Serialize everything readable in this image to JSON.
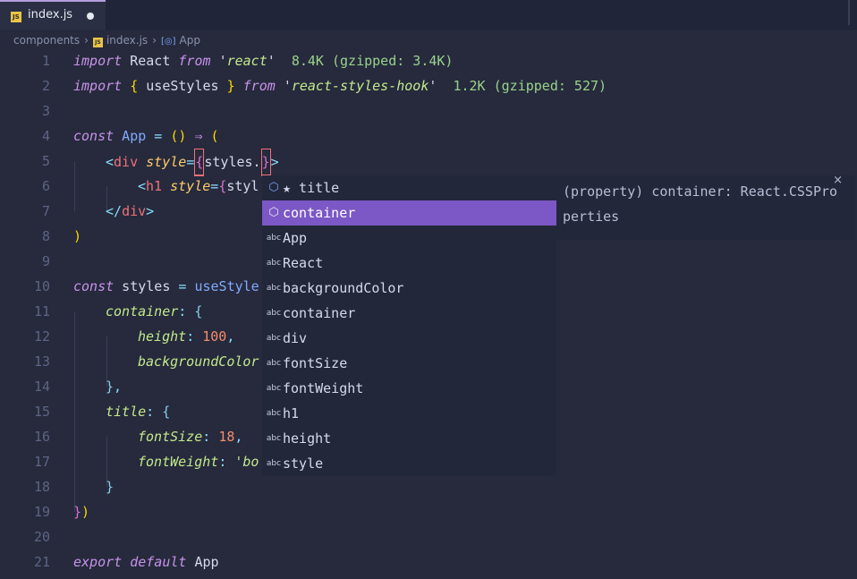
{
  "tab": {
    "icon_label": "JS",
    "name": "index.js"
  },
  "breadcrumb": {
    "folder": "components",
    "file": "index.js",
    "symbol": "App"
  },
  "line_numbers": [
    "1",
    "2",
    "3",
    "4",
    "5",
    "6",
    "7",
    "8",
    "9",
    "10",
    "11",
    "12",
    "13",
    "14",
    "15",
    "16",
    "17",
    "18",
    "19",
    "20",
    "21"
  ],
  "code": {
    "l1": {
      "kw1": "import",
      "id": " React ",
      "kw2": "from",
      "sp": " ",
      "q1": "'",
      "mod": "react",
      "q2": "'",
      "hint": "  8.4K (gzipped: 3.4K)"
    },
    "l2": {
      "kw1": "import",
      "ob": " { ",
      "id": "useStyles",
      "cb": " } ",
      "kw2": "from",
      "sp": " ",
      "q1": "'",
      "mod": "react-styles-hook",
      "q2": "'",
      "hint": "  1.2K (gzipped: 527)"
    },
    "l4": {
      "kw": "const",
      "name": " App",
      "eq": " = ",
      "p": "()",
      "arrow": " ⇒ ",
      "open": "("
    },
    "l5": {
      "lt": "<",
      "tag": "div",
      "attr": " style",
      "eq": "=",
      "ob": "{",
      "obj": "styles.",
      "cb": "}",
      "gt": ">"
    },
    "l6": {
      "lt": "<",
      "tag": "h1",
      "attr": " style",
      "eq": "=",
      "ob": "{",
      "obj": "styl"
    },
    "l7": {
      "lt": "</",
      "tag": "div",
      "gt": ">"
    },
    "l8": {
      "close": ")"
    },
    "l10": {
      "kw": "const",
      "name": " styles",
      "eq": " = ",
      "fn": "useStyle"
    },
    "l11": {
      "prop": "container",
      "colon": ": ",
      "ob": "{"
    },
    "l12": {
      "prop": "height",
      "colon": ": ",
      "num": "100",
      "comma": ","
    },
    "l13": {
      "prop": "backgroundColor"
    },
    "l14": {
      "cb": "}",
      "comma": ","
    },
    "l15": {
      "prop": "title",
      "colon": ": ",
      "ob": "{"
    },
    "l16": {
      "prop": "fontSize",
      "colon": ": ",
      "num": "18",
      "comma": ","
    },
    "l17": {
      "prop": "fontWeight",
      "colon": ": ",
      "str": "'bo"
    },
    "l18": {
      "cb": "}"
    },
    "l19": {
      "cb": "}",
      "cp": ")"
    },
    "l21": {
      "kw1": "export",
      "kw2": " default",
      "name": " App"
    }
  },
  "suggestions": [
    {
      "icon": "cube",
      "label": "★ title"
    },
    {
      "icon": "cube",
      "label": "container"
    },
    {
      "icon": "abc",
      "label": "App"
    },
    {
      "icon": "abc",
      "label": "React"
    },
    {
      "icon": "abc",
      "label": "backgroundColor"
    },
    {
      "icon": "abc",
      "label": "container"
    },
    {
      "icon": "abc",
      "label": "div"
    },
    {
      "icon": "abc",
      "label": "fontSize"
    },
    {
      "icon": "abc",
      "label": "fontWeight"
    },
    {
      "icon": "abc",
      "label": "h1"
    },
    {
      "icon": "abc",
      "label": "height"
    },
    {
      "icon": "abc",
      "label": "style"
    }
  ],
  "selected_suggestion": 1,
  "doc": {
    "text": "(property) container: React.CSSProperties",
    "close": "×"
  },
  "colors": {
    "accent": "#7c57c6",
    "background": "#262a3c",
    "keyword": "#c792ea",
    "string": "#c3e88d"
  }
}
